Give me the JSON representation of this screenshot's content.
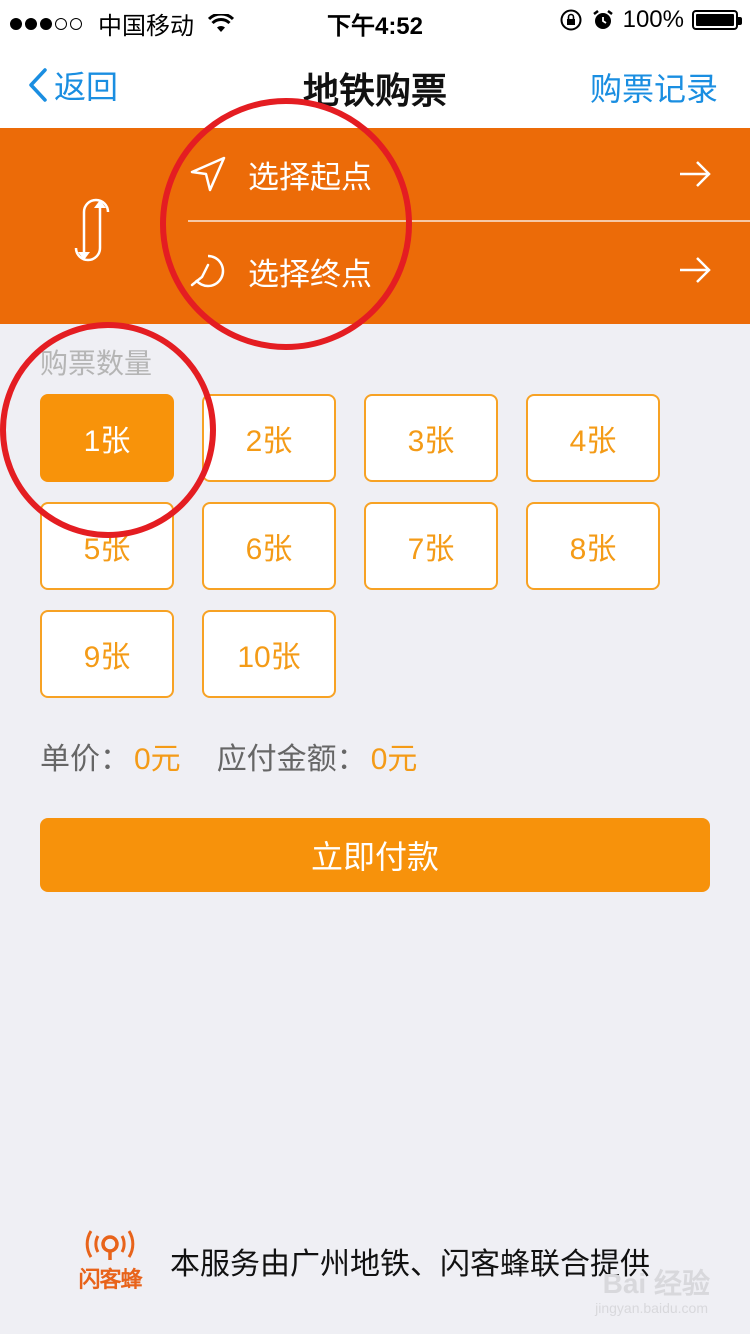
{
  "status_bar": {
    "carrier": "中国移动",
    "time": "下午4:52",
    "battery": "100%",
    "signal_strength": 3,
    "signal_max": 5,
    "battery_level": 100
  },
  "nav": {
    "back_label": "返回",
    "title": "地铁购票",
    "right_label": "购票记录"
  },
  "stations": {
    "start_label": "选择起点",
    "end_label": "选择终点"
  },
  "quantity": {
    "label": "购票数量",
    "options": [
      "1张",
      "2张",
      "3张",
      "4张",
      "5张",
      "6张",
      "7张",
      "8张",
      "9张",
      "10张"
    ],
    "selected": "1张"
  },
  "price": {
    "unit_label": "单价：",
    "unit_value": "0元",
    "total_label": "应付金额：",
    "total_value": "0元"
  },
  "pay_button": "立即付款",
  "footer": {
    "logo_text": "闪客蜂",
    "text": "本服务由广州地铁、闪客蜂联合提供"
  },
  "watermark": {
    "text": "Bai 经验",
    "sub": "jingyan.baidu.com"
  },
  "colors": {
    "panel_orange": "#ec6b08",
    "accent_orange": "#f7920b",
    "link_blue": "#1a8ee1",
    "annotation_red": "#e41d22"
  }
}
